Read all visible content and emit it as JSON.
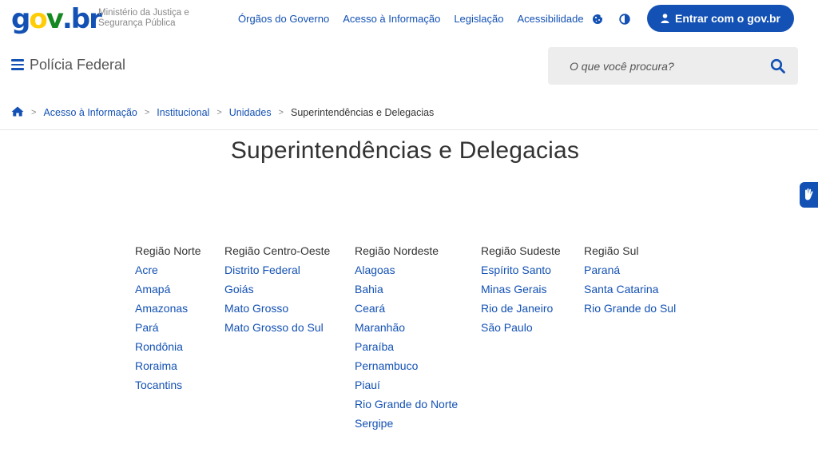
{
  "header": {
    "logo": {
      "g": "g",
      "o": "o",
      "v": "v",
      "dot": ".",
      "br": "br"
    },
    "ministry": [
      "Ministério da Justiça e",
      "Segurança Pública"
    ],
    "nav": [
      "Órgãos do Governo",
      "Acesso à Informação",
      "Legislação",
      "Acessibilidade"
    ],
    "icons": [
      "cookie-icon",
      "contrast-icon"
    ],
    "login_label": "Entrar com o gov.br"
  },
  "menu": {
    "site_title": "Polícia Federal",
    "search_placeholder": "O que você procura?"
  },
  "breadcrumb": {
    "items": [
      "Acesso à Informação",
      "Institucional",
      "Unidades"
    ],
    "current": "Superintendências e Delegacias"
  },
  "page": {
    "title": "Superintendências e Delegacias"
  },
  "regions": [
    {
      "name": "Região Norte",
      "states": [
        "Acre",
        "Amapá",
        "Amazonas",
        "Pará",
        "Rondônia",
        "Roraima",
        "Tocantins"
      ]
    },
    {
      "name": "Região Centro-Oeste",
      "states": [
        "Distrito Federal",
        "Goiás",
        "Mato Grosso",
        "Mato Grosso do Sul"
      ]
    },
    {
      "name": "Região Nordeste",
      "states": [
        "Alagoas",
        "Bahia",
        "Ceará",
        "Maranhão",
        "Paraíba",
        "Pernambuco",
        "Piauí",
        "Rio Grande do Norte",
        "Sergipe"
      ]
    },
    {
      "name": "Região Sudeste",
      "states": [
        "Espírito Santo",
        "Minas Gerais",
        "Rio de Janeiro",
        "São Paulo"
      ]
    },
    {
      "name": "Região Sul",
      "states": [
        "Paraná",
        "Santa Catarina",
        "Rio Grande do Sul"
      ]
    }
  ],
  "colors": {
    "primary": "#1351b4",
    "yellow": "#ffcd07",
    "green": "#168821",
    "search_bg": "#ededed"
  }
}
